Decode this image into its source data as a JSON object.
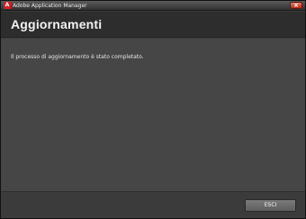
{
  "window": {
    "title": "Adobe Application Manager",
    "app_icon_glyph": "A",
    "close_glyph": "×"
  },
  "header": {
    "title": "Aggiornamenti"
  },
  "main": {
    "message": "Il processo di aggiornamento è stato completato."
  },
  "footer": {
    "exit_label": "ESCI"
  },
  "colors": {
    "background": "#464646",
    "header": "#2d2d2d",
    "button": "#6a6a6a",
    "close_button": "#c4412e",
    "app_icon": "#d21f26"
  }
}
